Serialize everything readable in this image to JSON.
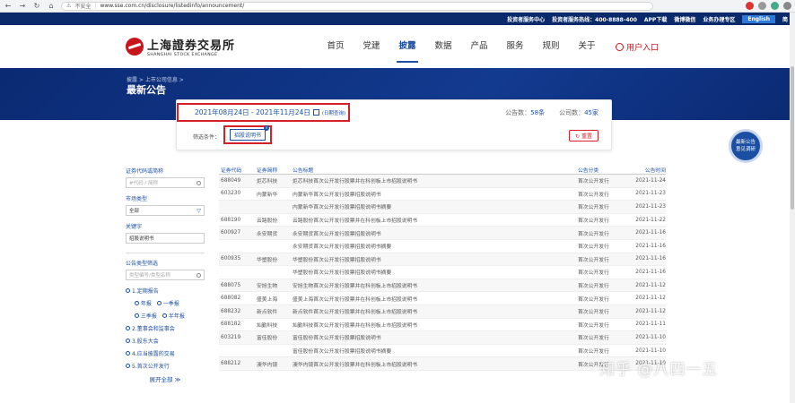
{
  "browser": {
    "security_label": "不安全",
    "url": "www.sse.com.cn/disclosure/listedinfo/announcement/"
  },
  "topbar": {
    "links": [
      "投资者服务中心",
      "投资者服务热线：400-8888-400",
      "APP下载",
      "微博微信",
      "业务办理专区"
    ],
    "lang_en": "English",
    "lang_zh": "简"
  },
  "logo": {
    "cn": "上海證券交易所",
    "en": "SHANGHAI STOCK EXCHANGE"
  },
  "nav": {
    "items": [
      "首页",
      "党建",
      "披露",
      "数据",
      "产品",
      "服务",
      "规则",
      "关于"
    ],
    "active_index": 2,
    "login": "用户入口"
  },
  "banner": {
    "breadcrumb": "披露 > 上市公司信息 >",
    "title": "最新公告"
  },
  "filter": {
    "date_range": "2021年08月24日 - 2021年11月24日",
    "date_query": "(日期查询)",
    "notice_count_label": "公告数：",
    "notice_count": "58条",
    "company_count_label": "公司数：",
    "company_count": "45家",
    "filter_label": "筛选条件：",
    "tag": "招股说明书",
    "reset": "重置"
  },
  "bubble": {
    "line1": "最新公告",
    "line2": "意见调研"
  },
  "sidebar": {
    "code_label": "证券代码或简称",
    "code_placeholder": "#代码 / 简称",
    "market_label": "市场类型",
    "market_value": "全部",
    "keyword_label": "关键字",
    "keyword_value": "招股说明书",
    "type_label": "公告类型筛选",
    "type_placeholder": "类型编号/类型名称",
    "opt1": "1.定期报告",
    "opt1_subs": [
      "年报",
      "一季报"
    ],
    "opt1_subs2": [
      "三季报",
      "半年报"
    ],
    "opt2": "2.董事会和监事会",
    "opt3": "3.股东大会",
    "opt4": "4.应当披露的交易",
    "opt5": "5.首次公开发行",
    "expand": "展开全部"
  },
  "table": {
    "headers": [
      "证券代码",
      "证券简称",
      "公告标题",
      "公告分类",
      "公告时间"
    ],
    "rows": [
      [
        "688049",
        "炬芯科技",
        "炬芯科技首次公开发行股票并在科创板上市招股说明书",
        "首次公开发行",
        "2021-11-24"
      ],
      [
        "603230",
        "内蒙新华",
        "内蒙新华首次公开发行股票招股说明书",
        "首次公开发行",
        "2021-11-23"
      ],
      [
        "",
        "",
        "内蒙新华首次公开发行股票招股说明书摘要",
        "首次公开发行",
        "2021-11-23"
      ],
      [
        "688190",
        "云路股份",
        "云路股份首次公开发行股票并在科创板上市招股说明书",
        "首次公开发行",
        "2021-11-22"
      ],
      [
        "600927",
        "永安期货",
        "永安期货首次公开发行股票招股说明书",
        "首次公开发行",
        "2021-11-16"
      ],
      [
        "",
        "",
        "永安期货首次公开发行股票招股说明书摘要",
        "首次公开发行",
        "2021-11-16"
      ],
      [
        "600935",
        "华塑股份",
        "华塑股份首次公开发行股票招股说明书",
        "首次公开发行",
        "2021-11-16"
      ],
      [
        "",
        "",
        "华塑股份首次公开发行股票招股说明书摘要",
        "首次公开发行",
        "2021-11-16"
      ],
      [
        "688075",
        "安旭生物",
        "安旭生物首次公开发行股票并在科创板上市招股说明书",
        "首次公开发行",
        "2021-11-12"
      ],
      [
        "688082",
        "盛美上海",
        "盛美上海首次公开发行股票并在科创板上市招股说明书",
        "首次公开发行",
        "2021-11-12"
      ],
      [
        "688232",
        "新点软件",
        "新点软件首次公开发行股票并在科创板上市招股说明书",
        "首次公开发行",
        "2021-11-12"
      ],
      [
        "688182",
        "灿勤科技",
        "灿勤科技首次公开发行股票并在科创板上市招股说明书",
        "首次公开发行",
        "2021-11-11"
      ],
      [
        "603219",
        "富佳股份",
        "富佳股份首次公开发行股票招股说明书",
        "首次公开发行",
        "2021-11-10"
      ],
      [
        "",
        "",
        "富佳股份首次公开发行股票招股说明书摘要",
        "首次公开发行",
        "2021-11-10"
      ],
      [
        "688212",
        "澳华内镜",
        "澳华内镜首次公开发行股票并在科创板上市招股说明书",
        "首次公开发行",
        "2021-11-10"
      ]
    ]
  },
  "watermark": "知乎 @八四一五"
}
